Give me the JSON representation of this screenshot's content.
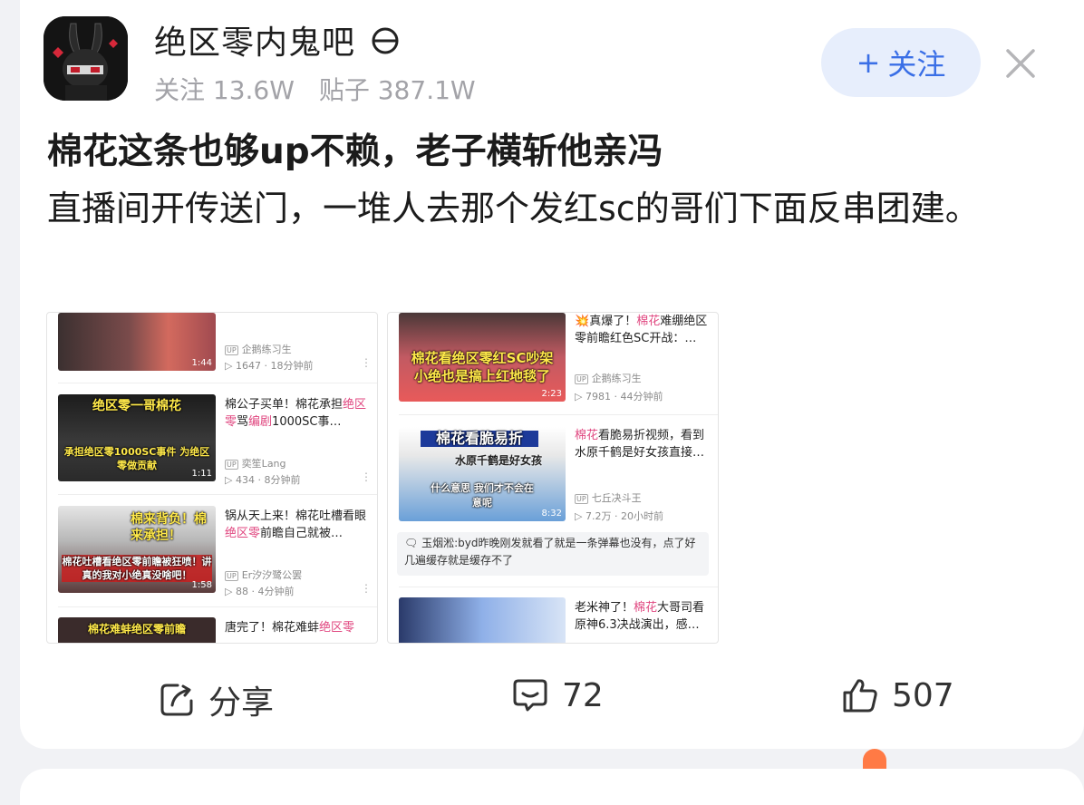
{
  "forum": {
    "name": "绝区零内鬼吧",
    "followers": "关注 13.6W",
    "posts": "贴子 387.1W",
    "follow_label": "关注",
    "follow_plus": "+"
  },
  "post": {
    "title": "棉花这条也够up不赖，老子横斩他亲冯",
    "body": "直播间开传送门，一堆人去那个发红sc的哥们下面反串团建。"
  },
  "screenshot_left": {
    "items": [
      {
        "title": "",
        "uploader": "企鹅练习生",
        "stats": "1647 · 18分钟前",
        "duration": "1:44",
        "caption": ""
      },
      {
        "title_a": "棉公子买单！棉花承担",
        "title_pink": "绝区零",
        "title_b": "骂",
        "title_pink2": "编剧",
        "title_c": "1000SC事…",
        "uploader": "奕笙Lang",
        "stats": "434 · 8分钟前",
        "duration": "1:11",
        "caption_top": "绝区零一哥棉花",
        "caption_bottom": "承担绝区零1000SC事件 为绝区零做贡献"
      },
      {
        "title_a": "锅从天上来！棉花吐槽看眼",
        "title_pink": "绝区零",
        "title_b": "前瞻自己就被…",
        "uploader": "Er汐汐鹭公罢",
        "stats": "88 · 4分钟前",
        "duration": "1:58",
        "caption_top": "棉来背负！棉来承担！",
        "caption_bottom": "棉花吐槽看绝区零前瞻被狂喷！讲真的我对小绝真没啥吧！"
      },
      {
        "title_a": "唐完了！棉花难蚌",
        "title_pink": "绝区零",
        "caption_top": "棉花难蚌绝区零前瞻"
      }
    ]
  },
  "screenshot_right": {
    "items": [
      {
        "title_a": "真爆了！",
        "title_pink": "棉花",
        "title_b": "难绷绝区零前瞻红色SC开战：…",
        "uploader": "企鹅练习生",
        "stats": "7981 · 44分钟前",
        "duration": "2:23",
        "caption": "棉花看绝区零红SC吵架 小绝也是搞上红地毯了"
      },
      {
        "title_pink": "棉花",
        "title_a": "看脆易折视频，看到水原千鹤是好女孩直接…",
        "uploader": "七丘决斗王",
        "stats": "7.2万 · 20小时前",
        "duration": "8:32",
        "caption_top": "棉花看脆易折",
        "caption_mid": "水原千鹤是好女孩",
        "caption_bottom": "什么意思 我们才不会在意呢"
      },
      {
        "comment_user": "玉烟淞:",
        "comment_text": "byd昨晚刚发就看了就是一条弹幕也没有，点了好几遍缓存就是缓存不了"
      },
      {
        "title_a": "老米神了！",
        "title_pink": "棉花",
        "title_b": "大哥司看原神6.3决战演出，感…"
      }
    ]
  },
  "actions": {
    "share": "分享",
    "comments": "72",
    "likes": "507"
  }
}
